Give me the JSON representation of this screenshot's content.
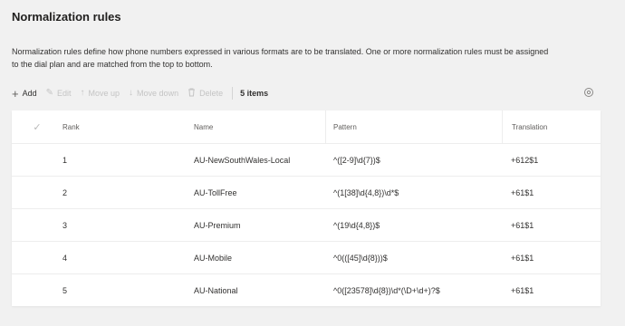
{
  "section": {
    "title": "Normalization rules",
    "description": "Normalization rules define how phone numbers expressed in various formats are to be translated. One or more normalization rules must be assigned to the dial plan and are matched from the top to bottom."
  },
  "toolbar": {
    "add_label": "Add",
    "edit_label": "Edit",
    "move_up_label": "Move up",
    "move_down_label": "Move down",
    "delete_label": "Delete",
    "count_label": "5 items"
  },
  "table": {
    "columns": {
      "rank": "Rank",
      "name": "Name",
      "pattern": "Pattern",
      "translation": "Translation"
    },
    "rows": [
      {
        "rank": "1",
        "name": "AU-NewSouthWales-Local",
        "pattern": "^([2-9]\\d{7})$",
        "translation": "+612$1"
      },
      {
        "rank": "2",
        "name": "AU-TollFree",
        "pattern": "^(1[38]\\d{4,8})\\d*$",
        "translation": "+61$1"
      },
      {
        "rank": "3",
        "name": "AU-Premium",
        "pattern": "^(19\\d{4,8})$",
        "translation": "+61$1"
      },
      {
        "rank": "4",
        "name": "AU-Mobile",
        "pattern": "^0(([45]\\d{8}))$",
        "translation": "+61$1"
      },
      {
        "rank": "5",
        "name": "AU-National",
        "pattern": "^0([23578]\\d{8})\\d*(\\D+\\d+)?$",
        "translation": "+61$1"
      }
    ]
  },
  "icons": {
    "add": "plus-icon",
    "edit": "pencil-icon",
    "move_up": "arrow-up-icon",
    "move_down": "arrow-down-icon",
    "delete": "trash-icon",
    "settings": "gear-icon",
    "select_all": "checkmark-icon"
  }
}
